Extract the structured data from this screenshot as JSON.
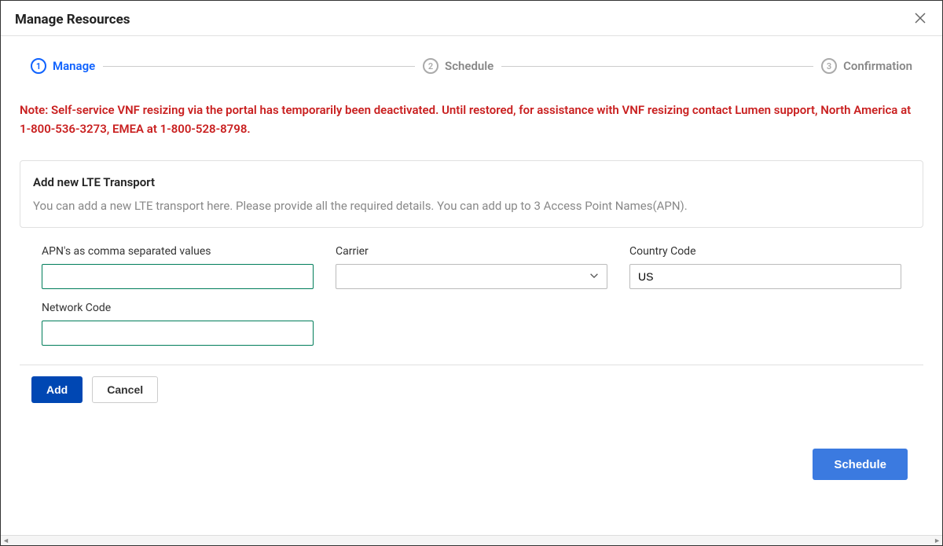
{
  "dialog": {
    "title": "Manage Resources"
  },
  "stepper": {
    "steps": [
      {
        "num": "1",
        "label": "Manage"
      },
      {
        "num": "2",
        "label": "Schedule"
      },
      {
        "num": "3",
        "label": "Confirmation"
      }
    ]
  },
  "note": "Note: Self-service VNF resizing via the portal has temporarily been deactivated. Until restored, for assistance with VNF resizing contact Lumen support, North America at 1-800-536-3273, EMEA at 1-800-528-8798.",
  "card": {
    "title": "Add new LTE Transport",
    "desc": "You can add a new LTE transport here. Please provide all the required details. You can add up to 3 Access Point Names(APN)."
  },
  "form": {
    "apn": {
      "label": "APN's as comma separated values",
      "value": ""
    },
    "carrier": {
      "label": "Carrier",
      "value": ""
    },
    "country_code": {
      "label": "Country Code",
      "value": "US"
    },
    "network_code": {
      "label": "Network Code",
      "value": ""
    }
  },
  "buttons": {
    "add": "Add",
    "cancel": "Cancel",
    "schedule": "Schedule"
  }
}
